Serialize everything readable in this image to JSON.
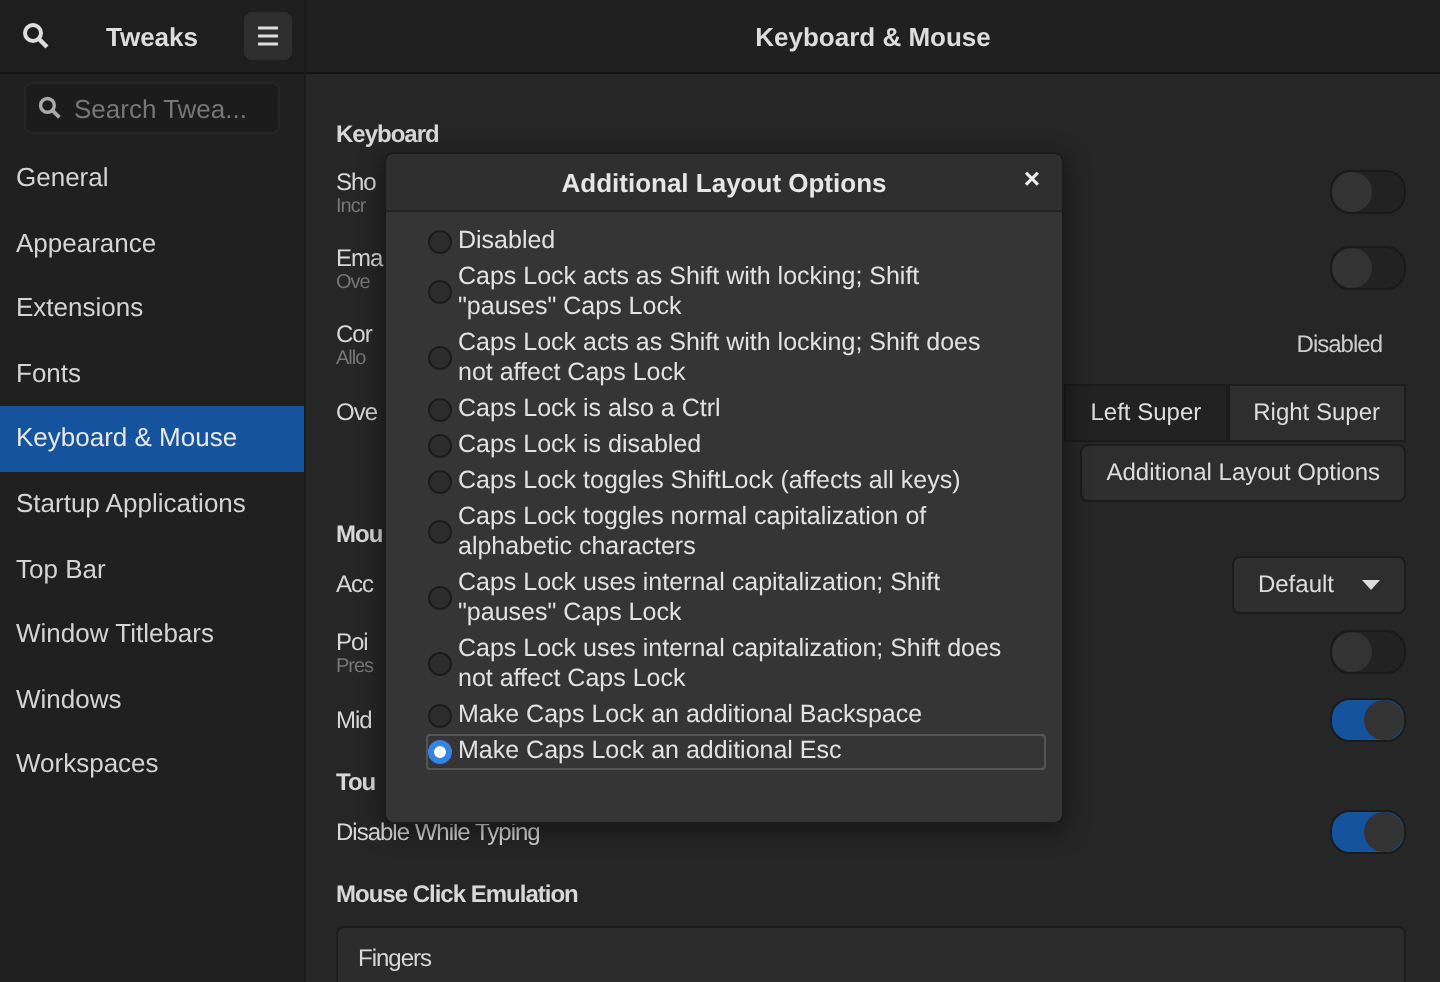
{
  "sidebar": {
    "title": "Tweaks",
    "search": {
      "placeholder": "Search Twea..."
    },
    "items": [
      {
        "label": "General",
        "selected": false
      },
      {
        "label": "Appearance",
        "selected": false
      },
      {
        "label": "Extensions",
        "selected": false
      },
      {
        "label": "Fonts",
        "selected": false
      },
      {
        "label": "Keyboard & Mouse",
        "selected": true
      },
      {
        "label": "Startup Applications",
        "selected": false
      },
      {
        "label": "Top Bar",
        "selected": false
      },
      {
        "label": "Window Titlebars",
        "selected": false
      },
      {
        "label": "Windows",
        "selected": false
      },
      {
        "label": "Workspaces",
        "selected": false
      }
    ]
  },
  "window": {
    "title": "Keyboard & Mouse"
  },
  "content": [
    {
      "kind": "heading",
      "label": "Keyboard"
    },
    {
      "kind": "switch",
      "label": "Sho",
      "hint": "Incr",
      "on": false
    },
    {
      "kind": "switch",
      "label": "Ema",
      "hint": "Ove",
      "on": false
    },
    {
      "kind": "value",
      "label": "Cor",
      "hint": "Allo",
      "value": "Disabled"
    },
    {
      "kind": "segments",
      "label": "Ove",
      "options": [
        {
          "label": "Left Super",
          "selected": true
        },
        {
          "label": "Right Super",
          "selected": false
        }
      ]
    },
    {
      "kind": "button",
      "label": "Additional Layout Options"
    },
    {
      "kind": "heading",
      "label": "Mou"
    },
    {
      "kind": "dropdown",
      "label": "Acc",
      "value": "Default"
    },
    {
      "kind": "switch",
      "label": "Poi",
      "hint": "Pres",
      "on": false
    },
    {
      "kind": "switch",
      "label": "Mid",
      "on": true
    },
    {
      "kind": "heading",
      "label": "Tou"
    },
    {
      "kind": "switch",
      "label": "Disable While Typing",
      "on": true
    },
    {
      "kind": "heading",
      "label": "Mouse Click Emulation"
    },
    {
      "kind": "card",
      "label": "Fingers"
    }
  ],
  "dialog": {
    "title": "Additional Layout Options",
    "close": "×",
    "options": [
      {
        "label": "Disabled",
        "selected": false
      },
      {
        "label": "Caps Lock acts as Shift with locking; Shift \"pauses\" Caps Lock",
        "selected": false
      },
      {
        "label": "Caps Lock acts as Shift with locking; Shift does not affect Caps Lock",
        "selected": false
      },
      {
        "label": "Caps Lock is also a Ctrl",
        "selected": false
      },
      {
        "label": "Caps Lock is disabled",
        "selected": false
      },
      {
        "label": "Caps Lock toggles ShiftLock (affects all keys)",
        "selected": false
      },
      {
        "label": "Caps Lock toggles normal capitalization of alphabetic characters",
        "selected": false
      },
      {
        "label": "Caps Lock uses internal capitalization; Shift \"pauses\" Caps Lock",
        "selected": false
      },
      {
        "label": "Caps Lock uses internal capitalization; Shift does not affect Caps Lock",
        "selected": false
      },
      {
        "label": "Make Caps Lock an additional Backspace",
        "selected": false
      },
      {
        "label": "Make Caps Lock an additional Esc",
        "selected": true
      }
    ]
  }
}
